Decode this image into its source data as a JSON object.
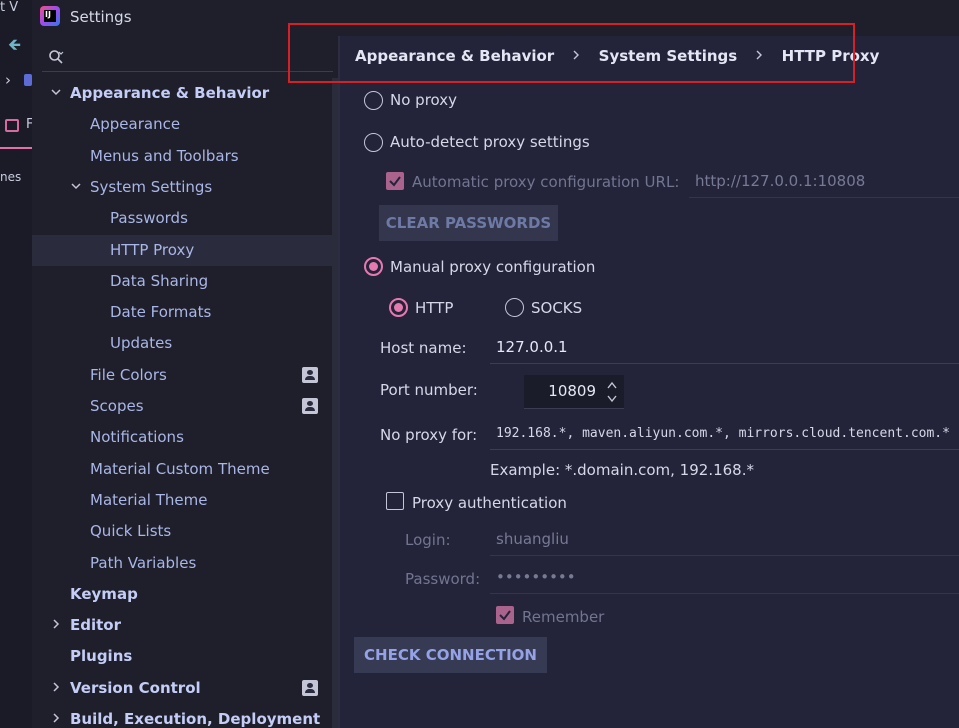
{
  "background": {
    "menu_fragment": "t  V",
    "tab_fragment": "F",
    "text_fragment": "nes"
  },
  "window": {
    "title": "Settings"
  },
  "search": {
    "placeholder": ""
  },
  "sidebar": {
    "items": [
      {
        "label": "Appearance & Behavior",
        "level": 0,
        "bold": true,
        "expanded": true
      },
      {
        "label": "Appearance",
        "level": 1
      },
      {
        "label": "Menus and Toolbars",
        "level": 1
      },
      {
        "label": "System Settings",
        "level": 1,
        "expanded": true
      },
      {
        "label": "Passwords",
        "level": 2
      },
      {
        "label": "HTTP Proxy",
        "level": 2,
        "selected": true
      },
      {
        "label": "Data Sharing",
        "level": 2
      },
      {
        "label": "Date Formats",
        "level": 2
      },
      {
        "label": "Updates",
        "level": 2
      },
      {
        "label": "File Colors",
        "level": 1,
        "badge": true
      },
      {
        "label": "Scopes",
        "level": 1,
        "badge": true
      },
      {
        "label": "Notifications",
        "level": 1
      },
      {
        "label": "Material Custom Theme",
        "level": 1
      },
      {
        "label": "Material Theme",
        "level": 1
      },
      {
        "label": "Quick Lists",
        "level": 1
      },
      {
        "label": "Path Variables",
        "level": 1
      },
      {
        "label": "Keymap",
        "level": 0,
        "bold": true
      },
      {
        "label": "Editor",
        "level": 0,
        "bold": true,
        "collapsed": true
      },
      {
        "label": "Plugins",
        "level": 0,
        "bold": true
      },
      {
        "label": "Version Control",
        "level": 0,
        "bold": true,
        "collapsed": true,
        "badge": true
      },
      {
        "label": "Build, Execution, Deployment",
        "level": 0,
        "bold": true,
        "collapsed": true
      }
    ]
  },
  "breadcrumb": [
    "Appearance & Behavior",
    "System Settings",
    "HTTP Proxy"
  ],
  "proxy": {
    "no_proxy_label": "No proxy",
    "auto_detect_label": "Auto-detect proxy settings",
    "auto_config_url_label": "Automatic proxy configuration URL:",
    "auto_config_url_value": "http://127.0.0.1:10808",
    "clear_passwords_label": "CLEAR PASSWORDS",
    "manual_label": "Manual proxy configuration",
    "http_label": "HTTP",
    "socks_label": "SOCKS",
    "host_name_label": "Host name:",
    "host_name_value": "127.0.0.1",
    "port_label": "Port number:",
    "port_value": "10809",
    "no_proxy_for_label": "No proxy for:",
    "no_proxy_for_value": "192.168.*, maven.aliyun.com.*, mirrors.cloud.tencent.com.*",
    "example_text": "Example: *.domain.com, 192.168.*",
    "auth_label": "Proxy authentication",
    "login_label": "Login:",
    "login_value": "shuangliu",
    "password_label": "Password:",
    "password_value": "•••••••••",
    "remember_label": "Remember",
    "check_connection_label": "CHECK CONNECTION"
  },
  "colors": {
    "accent": "#e67ab0",
    "link_blue": "#95a3e6",
    "highlight_box": "#d61f26"
  }
}
